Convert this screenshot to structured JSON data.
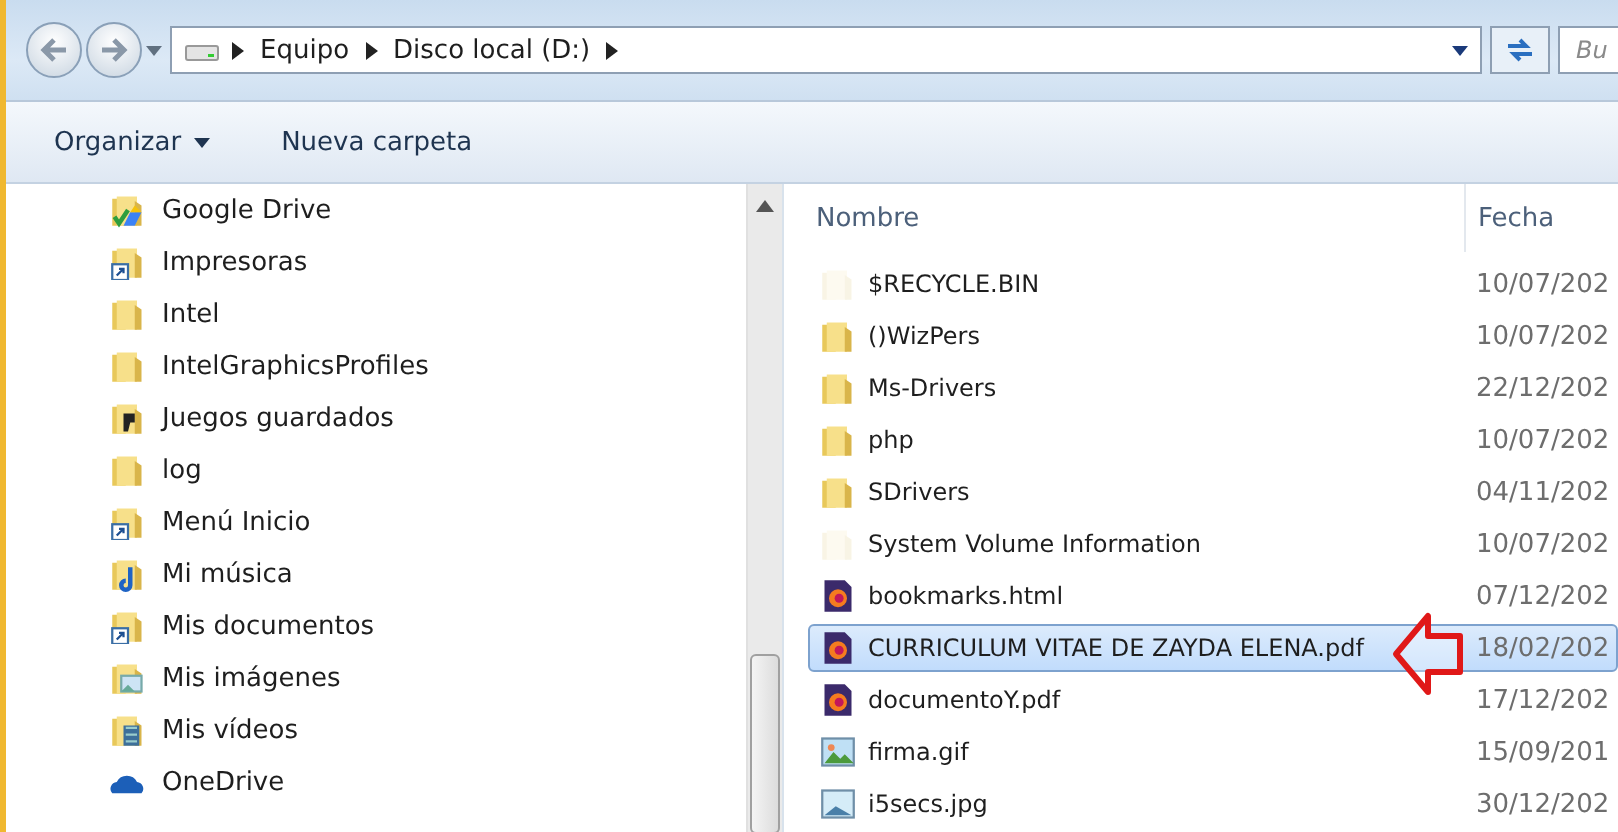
{
  "address_bar": {
    "crumbs": [
      "Equipo",
      "Disco local (D:)"
    ]
  },
  "search": {
    "placeholder": "Bu"
  },
  "toolbar": {
    "organize": "Organizar",
    "new_folder": "Nueva carpeta"
  },
  "nav_pane": {
    "items": [
      {
        "label": "Google Drive",
        "kind": "gdrive"
      },
      {
        "label": "Impresoras",
        "kind": "shortcut"
      },
      {
        "label": "Intel",
        "kind": "folder"
      },
      {
        "label": "IntelGraphicsProfiles",
        "kind": "folder"
      },
      {
        "label": "Juegos guardados",
        "kind": "games"
      },
      {
        "label": "log",
        "kind": "folder"
      },
      {
        "label": "Menú Inicio",
        "kind": "shortcut"
      },
      {
        "label": "Mi música",
        "kind": "music"
      },
      {
        "label": "Mis documentos",
        "kind": "shortcut"
      },
      {
        "label": "Mis imágenes",
        "kind": "pictures"
      },
      {
        "label": "Mis vídeos",
        "kind": "videos"
      },
      {
        "label": "OneDrive",
        "kind": "onedrive"
      }
    ]
  },
  "file_list": {
    "columns": [
      "Nombre",
      "Fecha"
    ],
    "rows": [
      {
        "name": "$RECYCLE.BIN",
        "date": "10/07/202",
        "kind": "folder",
        "hidden": true,
        "selected": false
      },
      {
        "name": "()WizPers",
        "date": "10/07/202",
        "kind": "folder",
        "hidden": false,
        "selected": false
      },
      {
        "name": "Ms-Drivers",
        "date": "22/12/202",
        "kind": "folder",
        "hidden": false,
        "selected": false
      },
      {
        "name": "php",
        "date": "10/07/202",
        "kind": "folder",
        "hidden": false,
        "selected": false
      },
      {
        "name": "SDrivers",
        "date": "04/11/202",
        "kind": "folder",
        "hidden": false,
        "selected": false
      },
      {
        "name": "System Volume Information",
        "date": "10/07/202",
        "kind": "folder",
        "hidden": true,
        "selected": false
      },
      {
        "name": "bookmarks.html",
        "date": "07/12/202",
        "kind": "firefox",
        "hidden": false,
        "selected": false
      },
      {
        "name": "CURRICULUM VITAE DE ZAYDA ELENA.pdf",
        "date": "18/02/202",
        "kind": "firefox",
        "hidden": false,
        "selected": true
      },
      {
        "name": "documentoY.pdf",
        "date": "17/12/202",
        "kind": "firefox",
        "hidden": false,
        "selected": false
      },
      {
        "name": "firma.gif",
        "date": "15/09/201",
        "kind": "gif",
        "hidden": false,
        "selected": false
      },
      {
        "name": "i5secs.jpg",
        "date": "30/12/202",
        "kind": "jpg",
        "hidden": false,
        "selected": false
      }
    ]
  }
}
